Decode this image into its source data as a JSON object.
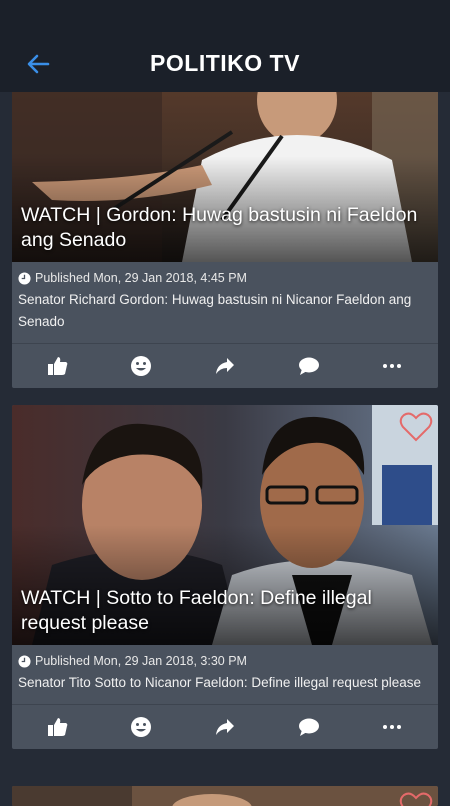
{
  "header": {
    "title": "POLITIKO TV",
    "back_icon": "arrow-left-icon"
  },
  "colors": {
    "topbar": "#1b2029",
    "background": "#252b36",
    "card": "#4a525e",
    "accent_back": "#3a8fe8",
    "heart": "#e46a6a"
  },
  "articles": [
    {
      "headline": "WATCH | Gordon: Huwag bastusin ni Faeldon ang Senado",
      "published": "Published Mon, 29 Jan 2018, 4:45 PM",
      "summary": "Senator Richard Gordon: Huwag bastusin ni Nicanor Faeldon ang Senado"
    },
    {
      "headline": "WATCH | Sotto to Faeldon: Define illegal request please",
      "published": "Published Mon, 29 Jan 2018, 3:30 PM",
      "summary": "Senator Tito Sotto to Nicanor Faeldon: Define illegal request please"
    }
  ],
  "actions": [
    "like-icon",
    "smiley-icon",
    "share-icon",
    "comment-icon",
    "more-icon"
  ]
}
